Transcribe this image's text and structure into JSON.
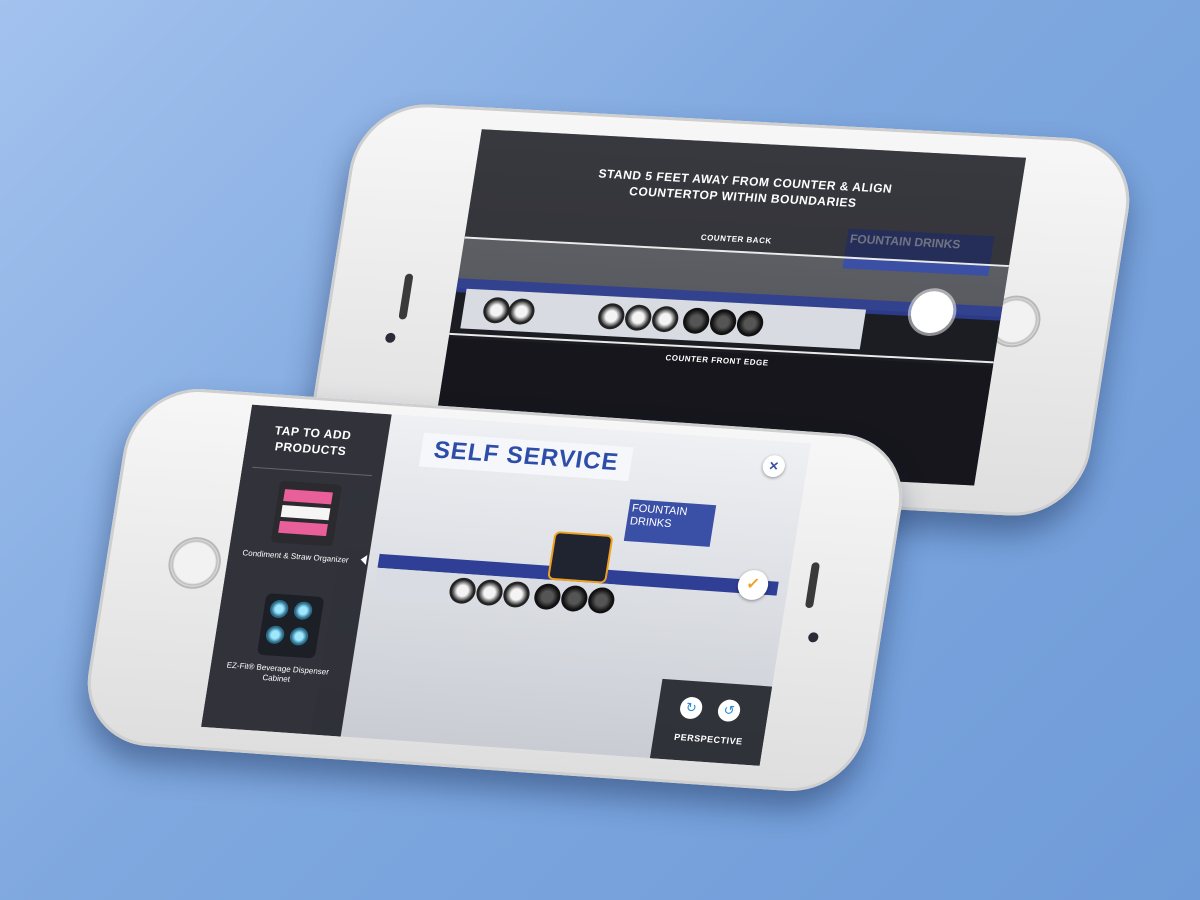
{
  "back_phone": {
    "instruction": "STAND 5 FEET AWAY FROM COUNTER & ALIGN COUNTERTOP WITHIN BOUNDARIES",
    "counter_back_label": "COUNTER BACK",
    "counter_front_label": "COUNTER FRONT EDGE",
    "scene_sign_1": "SELF SERVICE",
    "scene_sign_2": "FOUNTAIN DRINKS"
  },
  "front_phone": {
    "panel_title": "TAP TO ADD PRODUCTS",
    "products": [
      {
        "label": "Condiment & Straw Organizer"
      },
      {
        "label": "EZ-Fit® Beverage Dispenser Cabinet"
      }
    ],
    "sign_self_service": "SELF SERVICE",
    "sign_fountain": "FOUNTAIN DRINKS",
    "perspective_label": "PERSPECTIVE",
    "close_icon": "close-icon",
    "confirm_icon": "check-icon",
    "accent_blue": "#2b3f96",
    "confirm_orange": "#f0a020"
  }
}
